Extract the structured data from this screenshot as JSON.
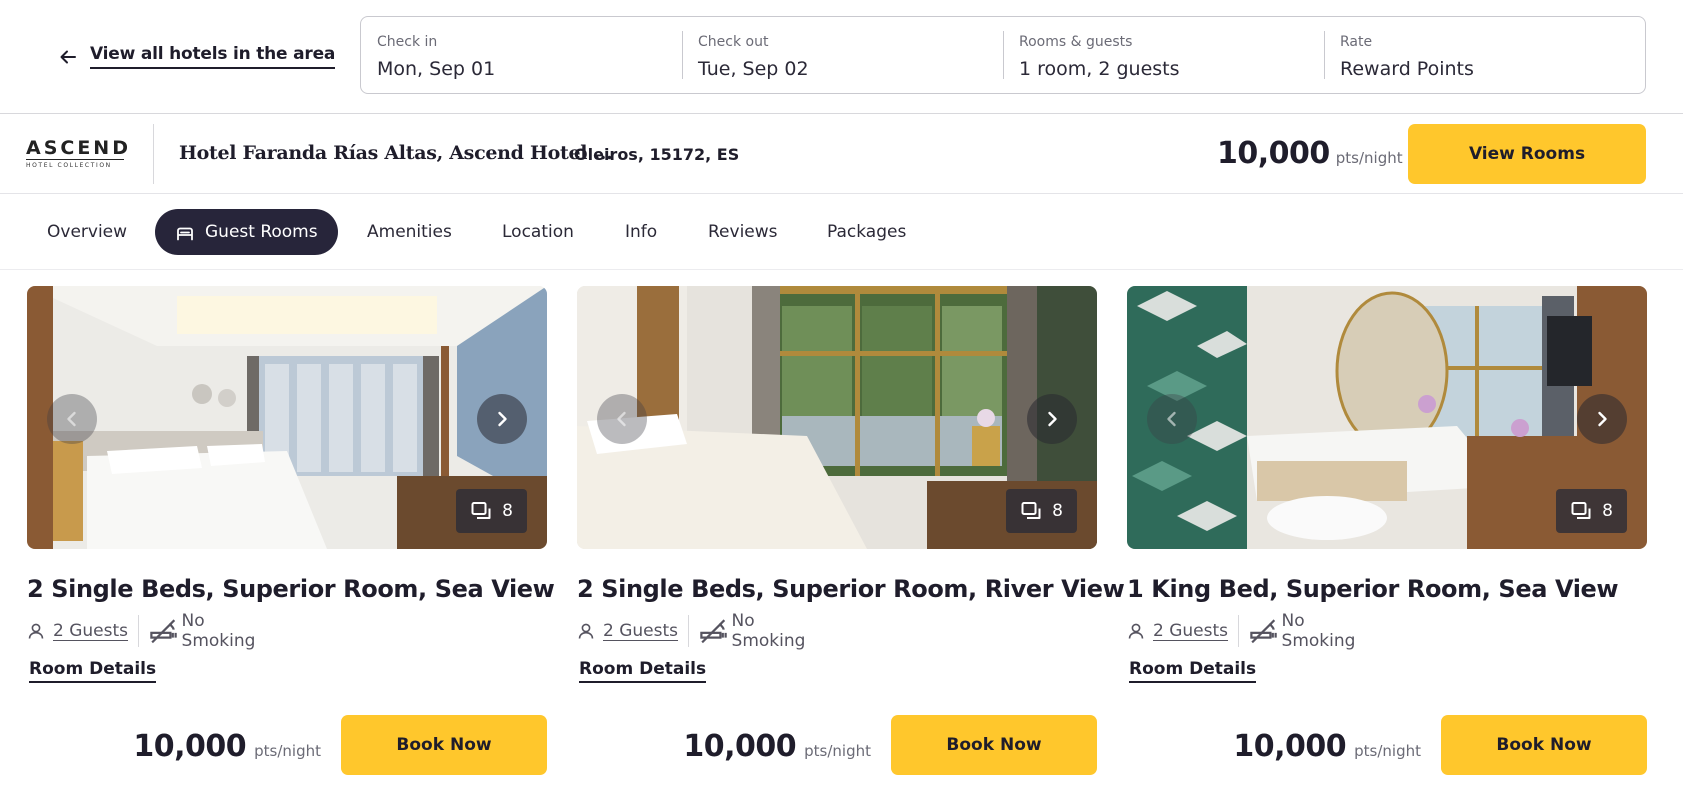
{
  "topbar": {
    "back_label": "View all hotels in the area",
    "search": {
      "check_in": {
        "label": "Check in",
        "value": "Mon, Sep 01"
      },
      "check_out": {
        "label": "Check out",
        "value": "Tue, Sep 02"
      },
      "rooms": {
        "label": "Rooms & guests",
        "value": "1 room, 2 guests"
      },
      "rate": {
        "label": "Rate",
        "value": "Reward Points"
      }
    }
  },
  "hotel": {
    "brand_main": "ASCEND",
    "brand_sub": "HOTEL COLLECTION",
    "name": "Hotel Faranda Rías Altas, Ascend Hotel ...",
    "location": "Oleiros, 15172, ES",
    "price_points": "10,000",
    "price_unit": "pts/night",
    "view_rooms_label": "View Rooms"
  },
  "tabs": [
    {
      "label": "Overview",
      "active": false
    },
    {
      "label": "Guest Rooms",
      "active": true
    },
    {
      "label": "Amenities",
      "active": false
    },
    {
      "label": "Location",
      "active": false
    },
    {
      "label": "Info",
      "active": false
    },
    {
      "label": "Reviews",
      "active": false
    },
    {
      "label": "Packages",
      "active": false
    }
  ],
  "rooms": [
    {
      "title": "2 Single Beds, Superior Room, Sea View",
      "photo_count": "8",
      "guests": "2 Guests",
      "smoking": "No Smoking",
      "details_label": "Room Details",
      "price_points": "10,000",
      "price_unit": "pts/night",
      "book_label": "Book Now"
    },
    {
      "title": "2 Single Beds, Superior Room, River View",
      "photo_count": "8",
      "guests": "2 Guests",
      "smoking": "No Smoking",
      "details_label": "Room Details",
      "price_points": "10,000",
      "price_unit": "pts/night",
      "book_label": "Book Now"
    },
    {
      "title": "1 King Bed, Superior Room, Sea View",
      "photo_count": "8",
      "guests": "2 Guests",
      "smoking": "No Smoking",
      "details_label": "Room Details",
      "price_points": "10,000",
      "price_unit": "pts/night",
      "book_label": "Book Now"
    }
  ],
  "colors": {
    "accent_yellow": "#ffc72c",
    "dark_navy": "#27253a",
    "text_dark": "#1f1d2b",
    "text_muted": "#6b6b76"
  },
  "icons": {
    "back": "arrow-left-icon",
    "bed": "bed-icon",
    "prev": "chevron-left-icon",
    "next": "chevron-right-icon",
    "gallery": "gallery-icon",
    "guests": "person-icon",
    "no_smoking": "no-smoking-icon"
  }
}
